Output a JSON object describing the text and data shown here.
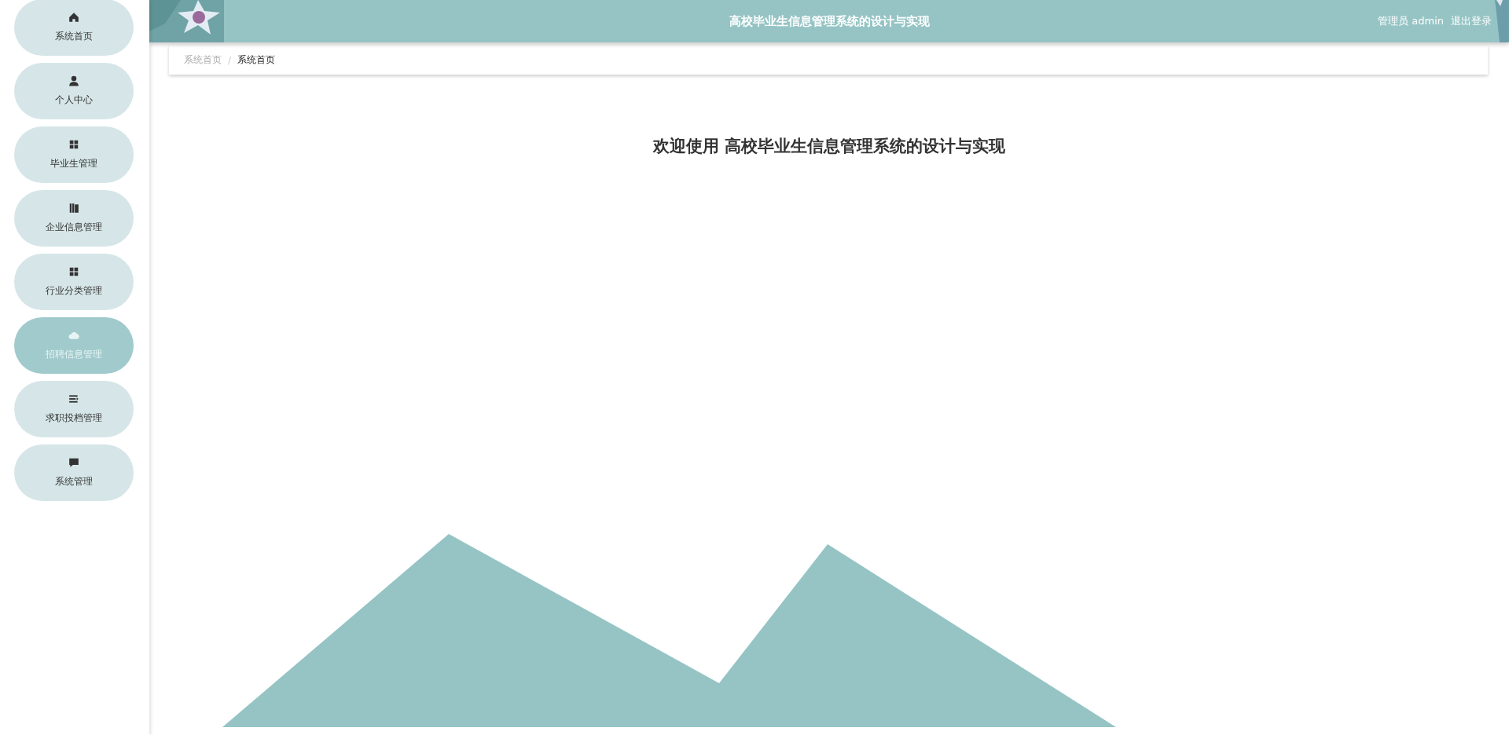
{
  "sidebar": {
    "items": [
      {
        "label": "系统首页",
        "selected": false
      },
      {
        "label": "个人中心",
        "selected": false
      },
      {
        "label": "毕业生管理",
        "selected": false
      },
      {
        "label": "企业信息管理",
        "selected": false
      },
      {
        "label": "行业分类管理",
        "selected": false
      },
      {
        "label": "招聘信息管理",
        "selected": true
      },
      {
        "label": "求职投档管理",
        "selected": false
      },
      {
        "label": "系统管理",
        "selected": false
      }
    ]
  },
  "header": {
    "title": "高校毕业生信息管理系统的设计与实现",
    "user": "管理员 admin",
    "logout": "退出登录"
  },
  "breadcrumb": {
    "items": [
      "系统首页",
      "系统首页"
    ],
    "separator": "/"
  },
  "welcome": "欢迎使用 高校毕业生信息管理系统的设计与实现"
}
